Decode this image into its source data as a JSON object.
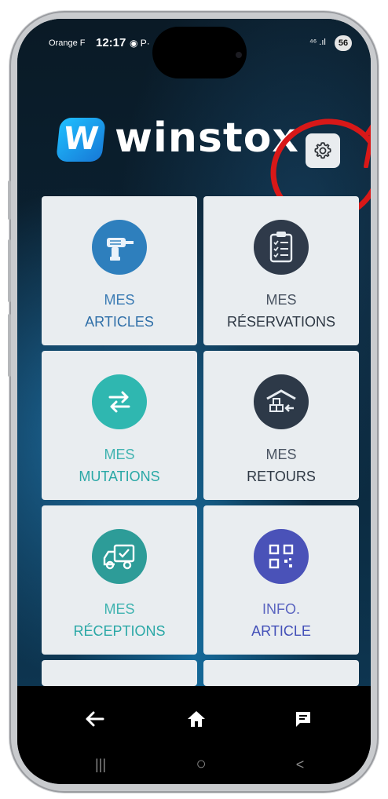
{
  "status_bar": {
    "carrier": "Orange F",
    "time": "12:17",
    "icons": "◉ P·",
    "signal": "⁴⁶ .ıl",
    "battery": "56"
  },
  "header": {
    "logo_letter": "W",
    "brand_name": "winstox",
    "settings_icon": "gear-icon"
  },
  "tiles": [
    {
      "line1": "MES",
      "line2": "ARTICLES",
      "icon": "drill-icon",
      "color": "#2e7fbd"
    },
    {
      "line1": "MES",
      "line2": "RÉSERVATIONS",
      "icon": "clipboard-icon",
      "color": "#2f3a4a"
    },
    {
      "line1": "MES",
      "line2": "MUTATIONS",
      "icon": "swap-arrows-icon",
      "color": "#2fb7b0"
    },
    {
      "line1": "MES",
      "line2": "RETOURS",
      "icon": "warehouse-return-icon",
      "color": "#2d3948"
    },
    {
      "line1": "MES",
      "line2": "RÉCEPTIONS",
      "icon": "truck-check-icon",
      "color": "#2d9c98"
    },
    {
      "line1": "INFO.",
      "line2": "ARTICLE",
      "icon": "qr-code-icon",
      "color": "#4a52b8"
    }
  ],
  "nav": {
    "back_icon": "arrow-left-icon",
    "home_icon": "home-icon",
    "chat_icon": "chat-icon",
    "recents_glyph": "|||",
    "home_glyph": "○",
    "back_glyph": "<"
  },
  "annotation_color": "#d81818"
}
